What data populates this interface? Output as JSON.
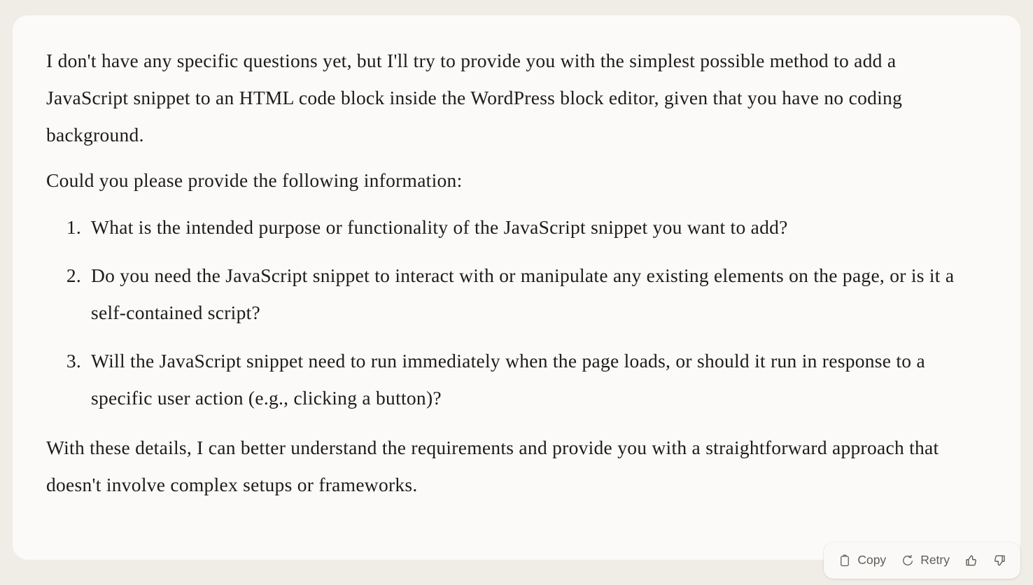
{
  "message": {
    "paragraph_1": "I don't have any specific questions yet, but I'll try to provide you with the simplest possible method to add a JavaScript snippet to an HTML code block inside the WordPress block editor, given that you have no coding background.",
    "paragraph_2": "Could you please provide the following information:",
    "questions": [
      "What is the intended purpose or functionality of the JavaScript snippet you want to add?",
      "Do you need the JavaScript snippet to interact with or manipulate any existing elements on the page, or is it a self-contained script?",
      "Will the JavaScript snippet need to run immediately when the page loads, or should it run in response to a specific user action (e.g., clicking a button)?"
    ],
    "paragraph_3": "With these details, I can better understand the requirements and provide you with a straightforward approach that doesn't involve complex setups or frameworks."
  },
  "toolbar": {
    "copy_label": "Copy",
    "retry_label": "Retry",
    "thumbs_up_icon": "thumbs-up-icon",
    "thumbs_down_icon": "thumbs-down-icon",
    "copy_icon": "clipboard-icon",
    "retry_icon": "refresh-ccw-icon"
  },
  "colors": {
    "page_background": "#f0ece6",
    "card_background": "#fbfaf8",
    "body_text": "#1d1c1a",
    "toolbar_text": "#5e5d56",
    "toolbar_background": "#faf9f7"
  }
}
